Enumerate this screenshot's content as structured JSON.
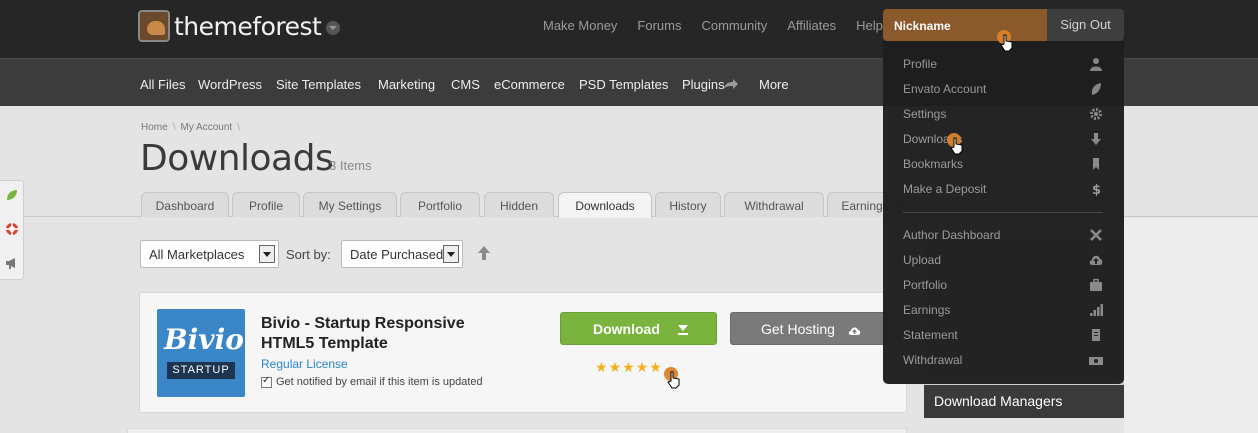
{
  "header": {
    "logo_text": "themeforest",
    "top_links": [
      "Make Money",
      "Forums",
      "Community",
      "Affiliates",
      "Help"
    ],
    "nickname": "Nickname",
    "sign_out": "Sign Out"
  },
  "main_nav": {
    "items": [
      "All Files",
      "WordPress",
      "Site Templates",
      "Marketing",
      "CMS",
      "eCommerce",
      "PSD Templates",
      "Plugins",
      "More"
    ]
  },
  "breadcrumb": [
    "Home",
    "My Account"
  ],
  "page": {
    "title": "Downloads",
    "count": "3 Items"
  },
  "tabs": [
    "Dashboard",
    "Profile",
    "My Settings",
    "Portfolio",
    "Hidden",
    "Downloads",
    "History",
    "Withdrawal",
    "Earnings"
  ],
  "active_tab": "Downloads",
  "filters": {
    "marketplace": "All Marketplaces",
    "sort_label": "Sort by:",
    "sort_value": "Date Purchased"
  },
  "item": {
    "brand": "Bivio",
    "badge": "STARTUP",
    "title": "Bivio - Startup Responsive HTML5 Template",
    "license": "Regular License",
    "notify": "Get notified by email if this item is updated",
    "download_label": "Download",
    "hosting_label": "Get Hosting",
    "rating": 5
  },
  "right_panel": {
    "download_managers": "Download Managers"
  },
  "dropdown": {
    "account_items": [
      {
        "label": "Profile",
        "icon": "user-icon"
      },
      {
        "label": "Envato Account",
        "icon": "leaf-icon"
      },
      {
        "label": "Settings",
        "icon": "gear-icon"
      },
      {
        "label": "Downloads",
        "icon": "download-arrow-icon"
      },
      {
        "label": "Bookmarks",
        "icon": "bookmark-icon"
      },
      {
        "label": "Make a Deposit",
        "icon": "dollar-icon"
      }
    ],
    "author_items": [
      {
        "label": "Author Dashboard",
        "icon": "tools-icon"
      },
      {
        "label": "Upload",
        "icon": "cloud-upload-icon"
      },
      {
        "label": "Portfolio",
        "icon": "briefcase-icon"
      },
      {
        "label": "Earnings",
        "icon": "bar-chart-icon"
      },
      {
        "label": "Statement",
        "icon": "statement-icon"
      },
      {
        "label": "Withdrawal",
        "icon": "money-icon"
      }
    ]
  },
  "colors": {
    "topbar": "#262626",
    "nav": "#3c3c3c",
    "nickname_bg": "#8a5a2c",
    "download_green": "#7ab43e",
    "link_blue": "#2a86c8",
    "star": "#f2b01e",
    "cursor": "#d9822b"
  }
}
